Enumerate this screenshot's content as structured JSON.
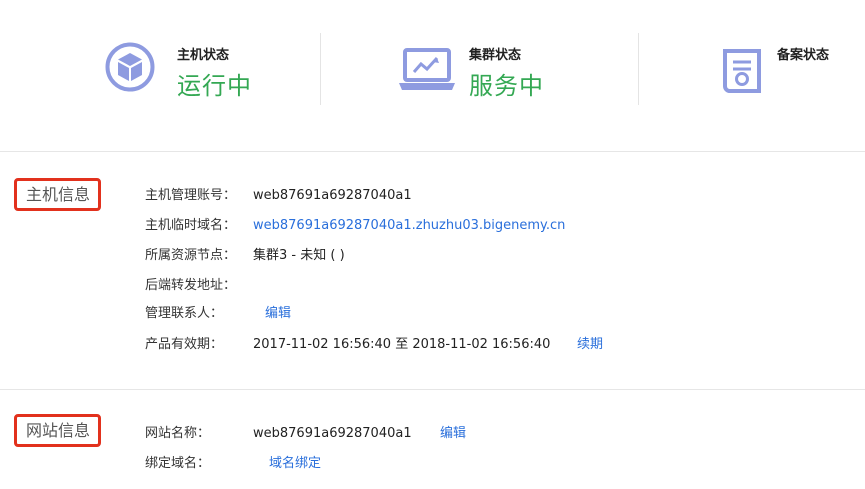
{
  "status": {
    "host": {
      "label": "主机状态",
      "value": "运行中",
      "icon": "cube-icon"
    },
    "cluster": {
      "label": "集群状态",
      "value": "服务中",
      "icon": "laptop-chart-icon"
    },
    "filing": {
      "label": "备案状态",
      "value": "",
      "icon": "document-scroll-icon"
    }
  },
  "host_info": {
    "title": "主机信息",
    "rows": [
      {
        "key": "主机管理账号：",
        "value": "web87691a69287040a1"
      },
      {
        "key": "主机临时域名：",
        "value": "web87691a69287040a1.zhuzhu03.bigenemy.cn"
      },
      {
        "key": "所属资源节点：",
        "value": "集群3 - 未知 ( )"
      },
      {
        "key": "后端转发地址：",
        "value": ""
      },
      {
        "key": "管理联系人：",
        "value": "",
        "link": "编辑"
      },
      {
        "key": "产品有效期：",
        "value": "2017-11-02 16:56:40 至 2018-11-02 16:56:40",
        "link": "续期"
      }
    ]
  },
  "site_info": {
    "title": "网站信息",
    "rows": [
      {
        "key": "网站名称：",
        "value": "web87691a69287040a1",
        "link": "编辑"
      },
      {
        "key": "绑定域名：",
        "value": "",
        "link": "域名绑定"
      }
    ]
  },
  "colors": {
    "accent_green": "#34a853",
    "link_blue": "#2a6fdb",
    "highlight_red": "#e2311d",
    "icon_blue": "#8e9be0"
  }
}
